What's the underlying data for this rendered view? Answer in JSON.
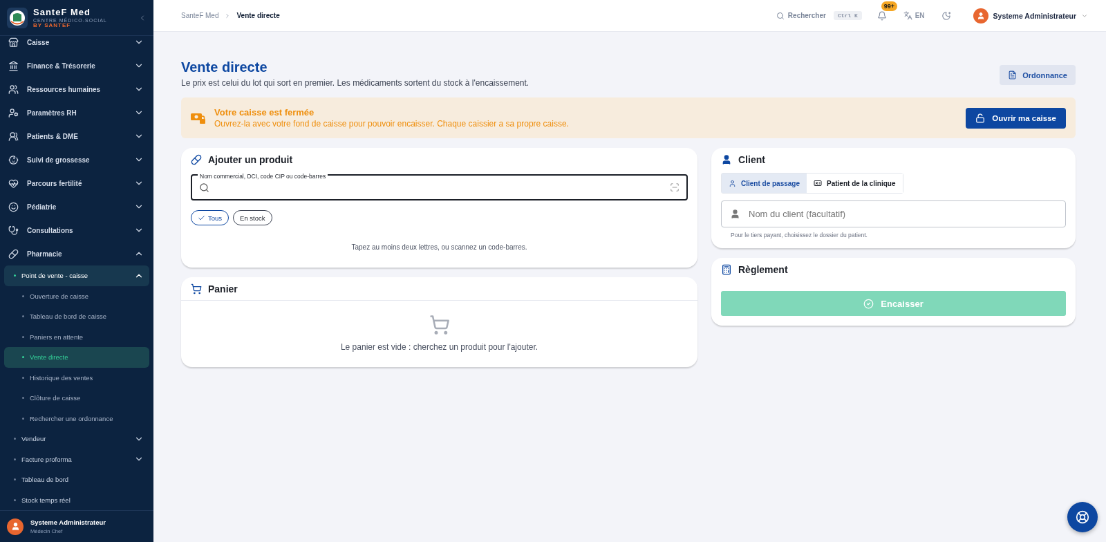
{
  "sidebar": {
    "brand": {
      "name": "SanteF Med",
      "subtitle": "CENTRE MÉDICO-SOCIAL",
      "tagline": "BY SANTEF"
    },
    "items": [
      {
        "label": "Caisse",
        "expanded": false
      },
      {
        "label": "Finance & Trésorerie",
        "expanded": false
      },
      {
        "label": "Ressources humaines",
        "expanded": false
      },
      {
        "label": "Paramètres RH",
        "expanded": false
      },
      {
        "label": "Patients & DME",
        "expanded": false
      },
      {
        "label": "Suivi de grossesse",
        "expanded": false
      },
      {
        "label": "Parcours fertilité",
        "expanded": false
      },
      {
        "label": "Pédiatrie",
        "expanded": false
      },
      {
        "label": "Consultations",
        "expanded": false
      },
      {
        "label": "Pharmacie",
        "expanded": true,
        "children": [
          {
            "label": "Point de vente - caisse",
            "expanded": true,
            "selected": true,
            "children": [
              {
                "label": "Ouverture de caisse",
                "selected": false
              },
              {
                "label": "Tableau de bord de caisse",
                "selected": false
              },
              {
                "label": "Paniers en attente",
                "selected": false
              },
              {
                "label": "Vente directe",
                "selected": true
              },
              {
                "label": "Historique des ventes",
                "selected": false
              },
              {
                "label": "Clôture de caisse",
                "selected": false
              },
              {
                "label": "Rechercher une ordonnance",
                "selected": false
              }
            ]
          },
          {
            "label": "Vendeur",
            "expanded": false,
            "selected": false
          },
          {
            "label": "Facture proforma",
            "expanded": false,
            "selected": false
          },
          {
            "label": "Tableau de bord",
            "selected": false
          },
          {
            "label": "Stock temps réel",
            "selected": false
          }
        ]
      }
    ],
    "user": {
      "name": "Systeme Administrateur",
      "role": "Médecin Chef"
    }
  },
  "header": {
    "breadcrumb": [
      "SanteF Med",
      "Vente directe"
    ],
    "search": "Rechercher",
    "shortcut": "Ctrl K",
    "notifications": "99+",
    "language": "EN",
    "user": "Systeme Administrateur"
  },
  "page": {
    "title": "Vente directe",
    "subtitle": "Le prix est celui du lot qui sort en premier. Les médicaments sortent du stock à l'encaissement.",
    "action": "Ordonnance"
  },
  "alert": {
    "title": "Votre caisse est fermée",
    "message": "Ouvrez-la avec votre fond de caisse pour pouvoir encaisser. Chaque caissier a sa propre caisse.",
    "button": "Ouvrir ma caisse"
  },
  "product": {
    "title": "Ajouter un produit",
    "field_label": "Nom commercial, DCI, code CIP ou code-barres",
    "filters": [
      {
        "label": "Tous",
        "selected": true
      },
      {
        "label": "En stock",
        "selected": false
      }
    ],
    "hint": "Tapez au moins deux lettres, ou scannez un code-barres."
  },
  "cart": {
    "title": "Panier",
    "empty": "Le panier est vide : cherchez un produit pour l'ajouter."
  },
  "client": {
    "title": "Client",
    "tabs": [
      {
        "label": "Client de passage",
        "selected": true
      },
      {
        "label": "Patient de la clinique",
        "selected": false
      }
    ],
    "placeholder": "Nom du client (facultatif)",
    "help": "Pour le tiers payant, choisissez le dossier du patient."
  },
  "payment": {
    "title": "Règlement",
    "button": "Encaisser",
    "disabled": true
  }
}
